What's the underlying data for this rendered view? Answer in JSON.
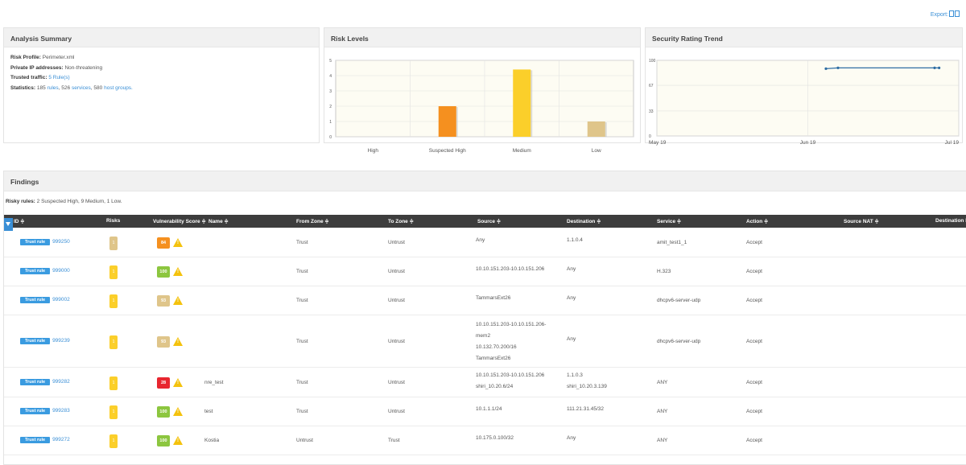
{
  "export_label": "Export:",
  "summary": {
    "title": "Analysis Summary",
    "risk_profile_label": "Risk Profile:",
    "risk_profile_value": "Perimeter.xml",
    "private_ip_label": "Private IP addresses:",
    "private_ip_value": "Non-threatening",
    "trusted_label": "Trusted traffic:",
    "trusted_value": "5 Rule(s)",
    "statistics_label": "Statistics:",
    "rules_count": "185",
    "rules_link": "rules",
    "services_count": "526",
    "services_link": "services",
    "hostgroups_count": "580",
    "hostgroups_link": "host groups."
  },
  "risk_levels": {
    "title": "Risk Levels",
    "chart_data": {
      "type": "bar",
      "categories": [
        "High",
        "Suspected High",
        "Medium",
        "Low"
      ],
      "values": [
        0,
        2,
        4.4,
        1
      ],
      "colors": [
        "#e8382d",
        "#f5901f",
        "#fbcf2a",
        "#dfc58a"
      ],
      "ylim": [
        0,
        5
      ],
      "yticks": [
        "0",
        "1",
        "2",
        "3",
        "4",
        "5"
      ],
      "grid": true
    }
  },
  "security_trend": {
    "title": "Security Rating Trend",
    "chart_data": {
      "type": "line",
      "x_labels": [
        "May 19",
        "Jun 19",
        "Jul 19"
      ],
      "yticks": [
        "0",
        "33",
        "67",
        "100"
      ],
      "ylim": [
        0,
        100
      ],
      "points": [
        [
          0.56,
          89
        ],
        [
          0.6,
          90
        ],
        [
          0.92,
          90
        ],
        [
          0.935,
          90
        ]
      ],
      "color": "#2e6da4",
      "grid": true
    }
  },
  "findings": {
    "title": "Findings",
    "risky_label": "Risky rules:",
    "risky_text": "2 Suspected High, 9 Medium, 1 Low.",
    "columns": [
      "ID ≑",
      "Risks",
      "Vulnerability Score ≑",
      "Name ≑",
      "From Zone ≑",
      "To Zone ≑",
      "Source ≑",
      "Destination ≑",
      "Service ≑",
      "Action ≑",
      "Source NAT ≑",
      "Destination N"
    ],
    "badge_label": "Trust rule",
    "rows": [
      {
        "id": "999250",
        "risk_color": "#dfc58a",
        "risk": "1",
        "score": "84",
        "score_color": "#f5901f",
        "name": "",
        "from": "Trust",
        "to": "Untrust",
        "source": [
          "Any"
        ],
        "dest": [
          "1.1.0.4"
        ],
        "service": "amit_test1_1",
        "action": "Accept"
      },
      {
        "id": "999000",
        "risk_color": "#fbcf2a",
        "risk": "1",
        "score": "100",
        "score_color": "#8cc63f",
        "name": "",
        "from": "Trust",
        "to": "Untrust",
        "source": [
          "10.10.151.203-10.10.151.206"
        ],
        "dest": [
          "Any"
        ],
        "service": "H.323",
        "action": "Accept"
      },
      {
        "id": "999002",
        "risk_color": "#fbcf2a",
        "risk": "1",
        "score": "93",
        "score_color": "#dfc58a",
        "name": "",
        "from": "Trust",
        "to": "Untrust",
        "source": [
          "TammarsExt26"
        ],
        "dest": [
          "Any"
        ],
        "service": "dhcpv6-server-udp",
        "action": "Accept"
      },
      {
        "id": "999239",
        "risk_color": "#fbcf2a",
        "risk": "1",
        "score": "93",
        "score_color": "#dfc58a",
        "name": "",
        "from": "Trust",
        "to": "Untrust",
        "source": [
          "10.10.151.203-10.10.151.206-",
          "mem2",
          "10.132.70.200/16",
          "TammarsExt26"
        ],
        "dest": [
          "Any"
        ],
        "service": "dhcpv6-server-udp",
        "action": "Accept"
      },
      {
        "id": "999282",
        "risk_color": "#fbcf2a",
        "risk": "1",
        "score": "28",
        "score_color": "#e8262f",
        "name": "nre_test",
        "from": "Trust",
        "to": "Untrust",
        "source": [
          "10.10.151.203-10.10.151.206",
          "shiri_10.20.6/24"
        ],
        "dest": [
          "1.1.0.3",
          "shiri_10.20.3.139"
        ],
        "service": "ANY",
        "action": "Accept"
      },
      {
        "id": "999283",
        "risk_color": "#fbcf2a",
        "risk": "1",
        "score": "100",
        "score_color": "#8cc63f",
        "name": "test",
        "from": "Trust",
        "to": "Untrust",
        "source": [
          "10.1.1.1/24"
        ],
        "dest": [
          "111.21.31.45/32"
        ],
        "service": "ANY",
        "action": "Accept"
      },
      {
        "id": "999272",
        "risk_color": "#fbcf2a",
        "risk": "1",
        "score": "100",
        "score_color": "#8cc63f",
        "name": "Kostia",
        "from": "Untrust",
        "to": "Trust",
        "source": [
          "10.175.0.100/32"
        ],
        "dest": [
          "Any"
        ],
        "service": "ANY",
        "action": "Accept"
      }
    ]
  }
}
